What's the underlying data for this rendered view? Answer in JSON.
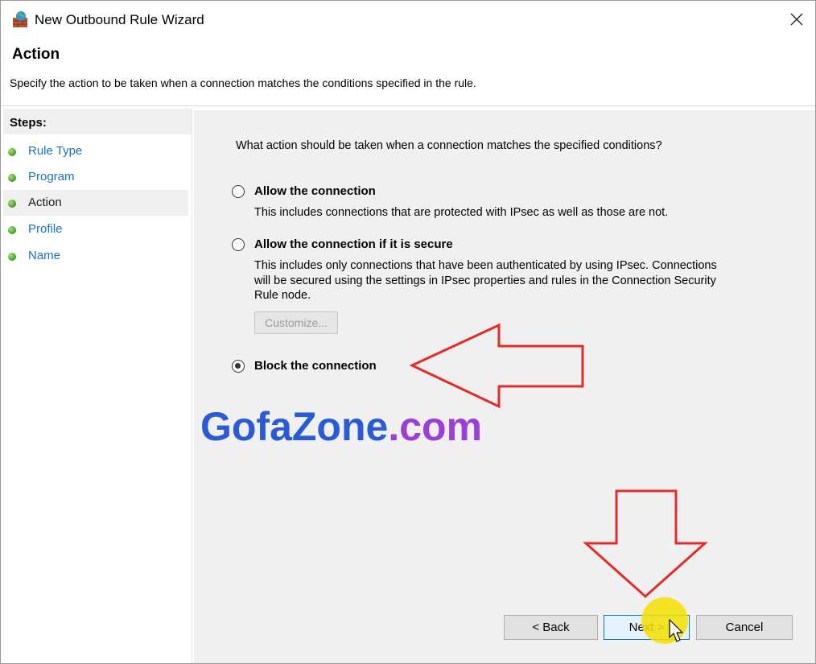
{
  "window": {
    "title": "New Outbound Rule Wizard",
    "icon": "firewall-globe-icon",
    "close_icon": "close-icon"
  },
  "header": {
    "title": "Action",
    "description": "Specify the action to be taken when a connection matches the conditions specified in the rule."
  },
  "steps": {
    "title": "Steps:",
    "items": [
      {
        "label": "Rule Type",
        "active": false
      },
      {
        "label": "Program",
        "active": false
      },
      {
        "label": "Action",
        "active": true
      },
      {
        "label": "Profile",
        "active": false
      },
      {
        "label": "Name",
        "active": false
      }
    ]
  },
  "content": {
    "question": "What action should be taken when a connection matches the specified conditions?",
    "options": [
      {
        "label": "Allow the connection",
        "description": "This includes connections that are protected with IPsec as well as those are not.",
        "selected": false
      },
      {
        "label": "Allow the connection if it is secure",
        "description_lines": [
          "This includes only connections that have been authenticated by using IPsec.  Connections",
          "will be secured using the settings in IPsec properties and rules in the Connection Security",
          "Rule node."
        ],
        "selected": false
      },
      {
        "label": "Block the connection",
        "selected": true
      }
    ],
    "customize_label": "Customize..."
  },
  "watermark": {
    "main": "GofaZone",
    "suffix": ".com"
  },
  "buttons": {
    "back": "< Back",
    "next": "Next >",
    "cancel": "Cancel"
  },
  "colors": {
    "accent_link": "#1a6fc6",
    "annotation_arrow": "#e52a2a",
    "cursor_highlight": "#f5e000",
    "watermark_blue": "#2b5ad7",
    "watermark_purple": "#9b3fd6"
  }
}
